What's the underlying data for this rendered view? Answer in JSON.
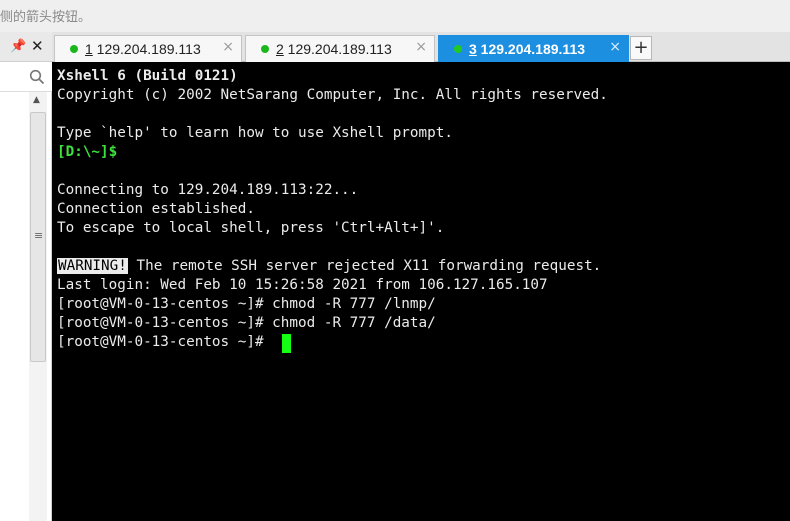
{
  "hint_bar": {
    "text": "侧的箭头按钮。"
  },
  "left_panel": {
    "pin_icon": "pin-icon",
    "close_icon": "close-icon",
    "search_icon": "search-icon"
  },
  "tabs": [
    {
      "number": "1",
      "host": " 129.204.189.113",
      "status_color": "#1bb61b",
      "active": false
    },
    {
      "number": "2",
      "host": " 129.204.189.113",
      "status_color": "#1bb61b",
      "active": false
    },
    {
      "number": "3",
      "host": " 129.204.189.113",
      "status_color": "#22c922",
      "active": true
    }
  ],
  "tab_close_glyph": "×",
  "new_tab_label": "+",
  "terminal": {
    "header": "Xshell 6 (Build 0121)",
    "copyright": "Copyright (c) 2002 NetSarang Computer, Inc. All rights reserved.",
    "help": "Type `help' to learn how to use Xshell prompt.",
    "local_prompt": "[D:\\~]$",
    "connecting": "Connecting to 129.204.189.113:22...",
    "established": "Connection established.",
    "escape": "To escape to local shell, press 'Ctrl+Alt+]'.",
    "warning_badge": "WARNING!",
    "warning_text": " The remote SSH server rejected X11 forwarding request.",
    "last_login": "Last login: Wed Feb 10 15:26:58 2021 from 106.127.165.107",
    "cmd1": "[root@VM-0-13-centos ~]# chmod -R 777 /lnmp/",
    "cmd2": "[root@VM-0-13-centos ~]# chmod -R 777 /data/",
    "prompt": "[root@VM-0-13-centos ~]# "
  },
  "colors": {
    "accent_tab": "#1d8fe1",
    "terminal_bg": "#000000",
    "prompt_green": "#3ee23e",
    "cursor": "#15ff15"
  }
}
